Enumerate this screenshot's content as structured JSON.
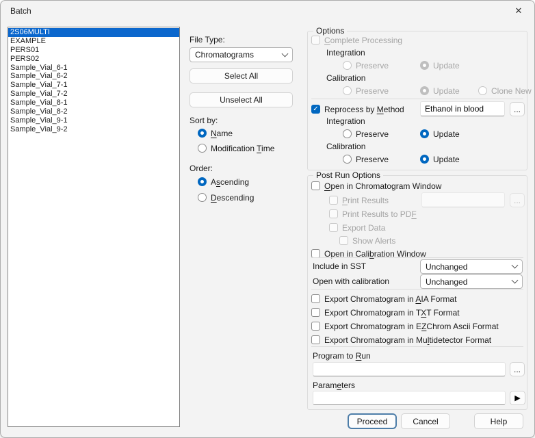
{
  "window": {
    "title": "Batch"
  },
  "icons": {
    "close": "✕",
    "check": "✓",
    "play": "▶",
    "browse": "...",
    "chevron_down": "chevron-down"
  },
  "file_list": {
    "items": [
      "2S06MULTI",
      "EXAMPLE",
      "PERS01",
      "PERS02",
      "Sample_Vial_6-1",
      "Sample_Vial_6-2",
      "Sample_Vial_7-1",
      "Sample_Vial_7-2",
      "Sample_Vial_8-1",
      "Sample_Vial_8-2",
      "Sample_Vial_9-1",
      "Sample_Vial_9-2"
    ],
    "selected_index": 0
  },
  "middle": {
    "file_type_label": "File Type:",
    "file_type_value": "Chromatograms",
    "select_all": "Select All",
    "unselect_all": "Unselect All",
    "sort_by_label": "Sort by:",
    "sort_name": "&Name",
    "sort_mtime": "Modification &Time",
    "order_label": "Order:",
    "order_asc": "A&scending",
    "order_desc": "&Descending"
  },
  "options": {
    "group_label": "Options",
    "complete_processing": "&Complete Processing",
    "integration_label": "Integration",
    "calibration_label": "Calibration",
    "preserve": "Preserve",
    "update": "Update",
    "clone_new": "Clone New",
    "reprocess_by_method": "Reprocess by &Method",
    "method_value": "Ethanol in blood"
  },
  "post_run": {
    "group_label": "Post Run Options",
    "open_chrom": "&Open in Chromatogram Window",
    "print_results": "&Print Results",
    "print_results_path": "",
    "print_pdf": "Print Results to PD&F",
    "export_data": "Export Data",
    "show_alerts": "Show Alerts",
    "open_calib": "Open in Cali&bration Window",
    "include_sst_label": "Include in SST",
    "include_sst_value": "Unchanged",
    "open_with_calib_label": "Open with calibration",
    "open_with_calib_value": "Unchanged",
    "export_aia": "Export Chromatogram in &AIA Format",
    "export_txt": "Export Chromatogram in T&XT Format",
    "export_ez": "Export Chromatogram in E&ZChrom Ascii Format",
    "export_multi": "Export Chromatogram in Mu&ltidetector Format",
    "program_label": "Program to &Run",
    "program_value": "",
    "params_label": "Param&eters",
    "params_value": ""
  },
  "footer": {
    "proceed": "Proceed",
    "cancel": "Cancel",
    "help": "Help"
  },
  "colors": {
    "accent": "#0067c0",
    "selection": "#0b67cd",
    "dialog_bg": "#f3f3f3"
  }
}
